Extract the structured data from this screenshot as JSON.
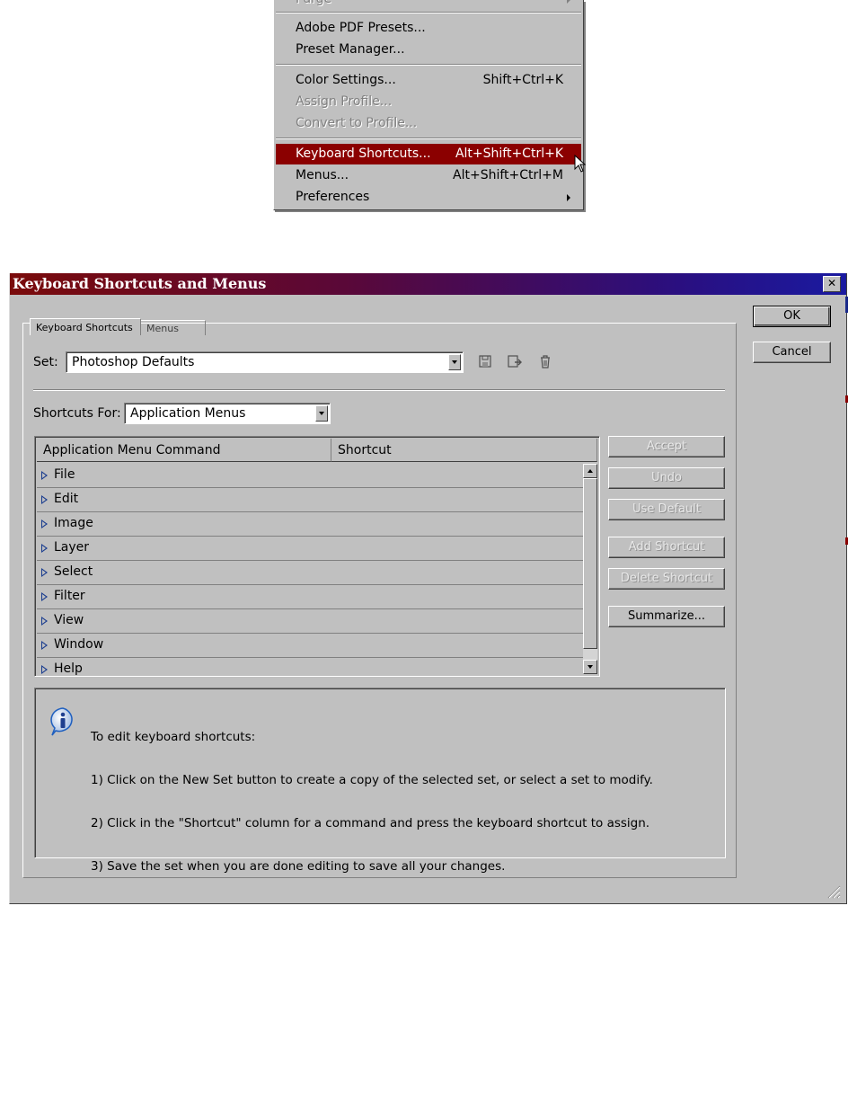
{
  "menu": {
    "top_partial_label": "Purge",
    "items": [
      {
        "label": "Adobe PDF Presets...",
        "shortcut": ""
      },
      {
        "label": "Preset Manager...",
        "shortcut": ""
      },
      {
        "label": "Color Settings...",
        "shortcut": "Shift+Ctrl+K"
      },
      {
        "label": "Assign Profile...",
        "shortcut": ""
      },
      {
        "label": "Convert to Profile...",
        "shortcut": ""
      },
      {
        "label": "Keyboard Shortcuts...",
        "shortcut": "Alt+Shift+Ctrl+K"
      },
      {
        "label": "Menus...",
        "shortcut": "Alt+Shift+Ctrl+M"
      },
      {
        "label": "Preferences",
        "shortcut": ""
      }
    ]
  },
  "dialog": {
    "title": "Keyboard Shortcuts and Menus",
    "close_glyph": "✕",
    "tabs": [
      {
        "label": "Keyboard Shortcuts"
      },
      {
        "label": "Menus"
      }
    ],
    "set_label": "Set:",
    "set_value": "Photoshop Defaults",
    "shortcuts_for_label": "Shortcuts For:",
    "shortcuts_for_value": "Application Menus",
    "columns": [
      "Application Menu Command",
      "Shortcut"
    ],
    "rows": [
      "File",
      "Edit",
      "Image",
      "Layer",
      "Select",
      "Filter",
      "View",
      "Window",
      "Help"
    ],
    "side_buttons": {
      "accept": "Accept",
      "undo": "Undo",
      "use_default": "Use Default",
      "add_shortcut": "Add Shortcut",
      "delete_shortcut": "Delete Shortcut",
      "summarize": "Summarize..."
    },
    "ok": "OK",
    "cancel": "Cancel",
    "info": {
      "line1": "To edit keyboard shortcuts:",
      "line2": "1) Click on the New Set button to create a copy of the selected set, or select a set to modify.",
      "line3": "2) Click in the \"Shortcut\" column for a command and press the keyboard shortcut to assign.",
      "line4": "3) Save the set when you are done editing to save all your changes."
    }
  },
  "colors": {
    "selection": "#8b0000",
    "face": "#c0c0c0",
    "tree_triangle": "#1a3d8f",
    "info_icon": "#1f5fbf"
  }
}
